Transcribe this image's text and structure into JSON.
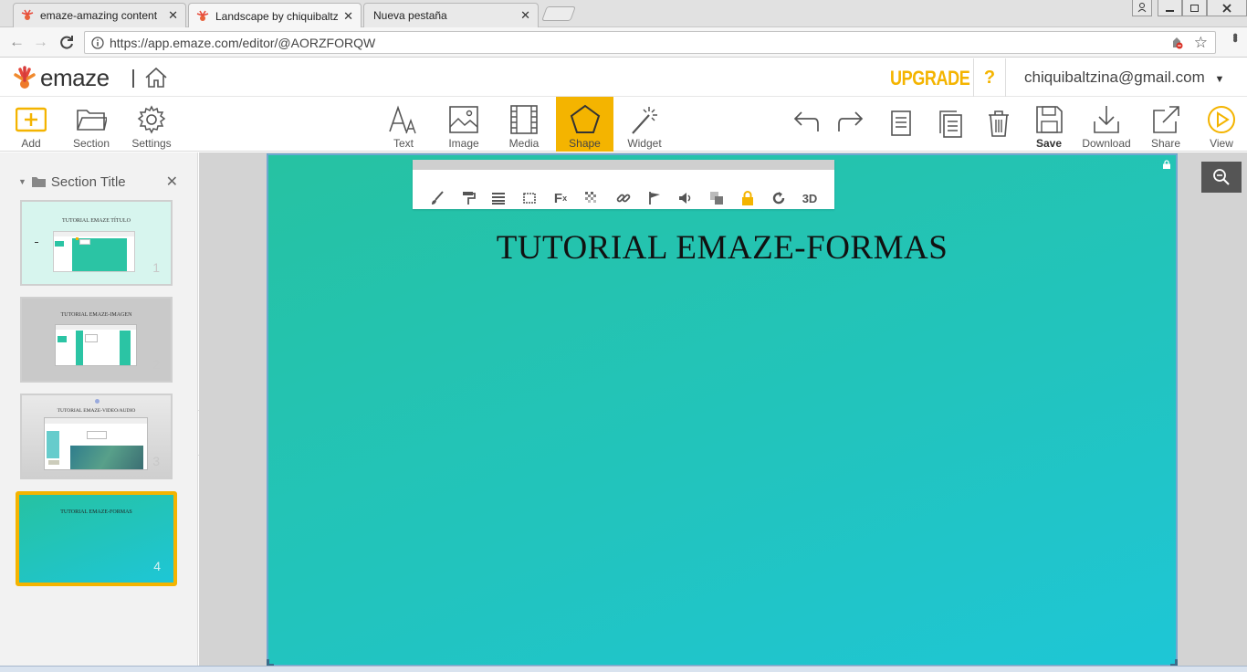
{
  "browser": {
    "tabs": [
      {
        "title": "emaze-amazing content"
      },
      {
        "title": "Landscape by chiquibaltz"
      },
      {
        "title": "Nueva pestaña"
      }
    ],
    "close_glyph": "✕",
    "url": "https://app.emaze.com/editor/@AORZFORQW"
  },
  "header": {
    "logo_text": "emaze",
    "upgrade_label": "UPGRADE",
    "help_label": "?",
    "user_email": "chiquibaltzina@gmail.com"
  },
  "toolbar": {
    "left": [
      {
        "label": "Add",
        "icon": "add-icon"
      },
      {
        "label": "Section",
        "icon": "folder-icon"
      },
      {
        "label": "Settings",
        "icon": "gear-icon"
      }
    ],
    "center": [
      {
        "label": "Text",
        "icon": "text-icon"
      },
      {
        "label": "Image",
        "icon": "image-icon"
      },
      {
        "label": "Media",
        "icon": "film-icon"
      },
      {
        "label": "Shape",
        "icon": "pentagon-icon",
        "active": true
      },
      {
        "label": "Widget",
        "icon": "magic-wand-icon"
      }
    ],
    "right": [
      {
        "label": "",
        "icon": "undo-icon"
      },
      {
        "label": "",
        "icon": "redo-icon"
      },
      {
        "label": "",
        "icon": "notes-icon"
      },
      {
        "label": "",
        "icon": "duplicate-icon"
      },
      {
        "label": "",
        "icon": "trash-icon"
      },
      {
        "label": "Save",
        "icon": "save-icon"
      },
      {
        "label": "Download",
        "icon": "download-icon"
      },
      {
        "label": "Share",
        "icon": "share-icon"
      },
      {
        "label": "View",
        "icon": "play-icon"
      }
    ],
    "accent_color": "#f4b400"
  },
  "sidebar": {
    "section_title": "Section Title",
    "slides": [
      {
        "title": "TUTORIAL EMAZE TÍTULO",
        "number": "1"
      },
      {
        "title": "TUTORIAL EMAZE-IMAGEN",
        "number": "2"
      },
      {
        "title": "TUTORIAL EMAZE-VIDEO/AUDIO",
        "number": "3"
      },
      {
        "title": "TUTORIAL EMAZE-FORMAS",
        "number": "4"
      }
    ]
  },
  "slide": {
    "title": "TUTORIAL EMAZE-FORMAS",
    "gradient_from": "#26c2a2",
    "gradient_to": "#1ec6d6"
  },
  "shape_toolbar": {
    "tools": [
      "brush-icon",
      "paint-roller-icon",
      "lines-icon",
      "border-icon",
      "effects-icon",
      "transparency-icon",
      "link-icon",
      "flag-icon",
      "sound-icon",
      "layers-icon",
      "lock-icon",
      "rotate-icon"
    ],
    "label_3d": "3D"
  }
}
